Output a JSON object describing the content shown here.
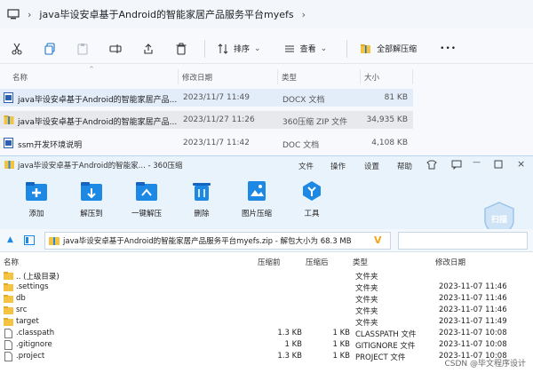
{
  "explorer": {
    "path": "java毕设安卓基于Android的智能家居产品服务平台myefs",
    "toolbar": {
      "sort_label": "排序",
      "view_label": "查看",
      "extract_all_label": "全部解压缩",
      "more_label": "•••"
    },
    "columns": {
      "name": "名称",
      "date": "修改日期",
      "type": "类型",
      "size": "大小"
    },
    "files": [
      {
        "name": "java毕设安卓基于Android的智能家居产品...",
        "date": "2023/11/7 11:49",
        "type": "DOCX 文档",
        "size": "81 KB"
      },
      {
        "name": "java毕设安卓基于Android的智能家居产品...",
        "date": "2023/11/27 11:26",
        "type": "360压缩 ZIP 文件",
        "size": "34,935 KB"
      },
      {
        "name": "ssm开发环境说明",
        "date": "2023/11/7 11:42",
        "type": "DOC 文档",
        "size": "4,108 KB"
      }
    ]
  },
  "zip": {
    "title": "java毕设安卓基于Android的智能家... - 360压缩",
    "menu": [
      "文件",
      "操作",
      "设置",
      "帮助"
    ],
    "ribbon": [
      {
        "label": "添加",
        "icon": "add-icon"
      },
      {
        "label": "解压到",
        "icon": "extract-to-icon"
      },
      {
        "label": "一键解压",
        "icon": "one-click-extract-icon"
      },
      {
        "label": "删除",
        "icon": "delete-icon"
      },
      {
        "label": "图片压缩",
        "icon": "image-compress-icon"
      },
      {
        "label": "工具",
        "icon": "tools-icon"
      }
    ],
    "scan_label": "扫描",
    "path_text": "java毕设安卓基于Android的智能家居产品服务平台myefs.zip - 解包大小为 68.3 MB",
    "columns": {
      "name": "名称",
      "before": "压缩前",
      "after": "压缩后",
      "type": "类型",
      "modified": "修改日期"
    },
    "rows": [
      {
        "name": ".. (上级目录)",
        "before": "",
        "after": "",
        "type": "文件夹",
        "date": "",
        "kind": "folder"
      },
      {
        "name": ".settings",
        "before": "",
        "after": "",
        "type": "文件夹",
        "date": "2023-11-07 11:46",
        "kind": "folder"
      },
      {
        "name": "db",
        "before": "",
        "after": "",
        "type": "文件夹",
        "date": "2023-11-07 11:46",
        "kind": "folder"
      },
      {
        "name": "src",
        "before": "",
        "after": "",
        "type": "文件夹",
        "date": "2023-11-07 11:46",
        "kind": "folder"
      },
      {
        "name": "target",
        "before": "",
        "after": "",
        "type": "文件夹",
        "date": "2023-11-07 11:49",
        "kind": "folder"
      },
      {
        "name": ".classpath",
        "before": "1.3 KB",
        "after": "1 KB",
        "type": "CLASSPATH 文件",
        "date": "2023-11-07 10:08",
        "kind": "file"
      },
      {
        "name": ".gitignore",
        "before": "1 KB",
        "after": "1 KB",
        "type": "GITIGNORE 文件",
        "date": "2023-11-07 10:08",
        "kind": "file"
      },
      {
        "name": ".project",
        "before": "1.3 KB",
        "after": "1 KB",
        "type": "PROJECT 文件",
        "date": "2023-11-07 10:08",
        "kind": "file"
      }
    ]
  },
  "watermark": "CSDN @毕文程序设计",
  "colors": {
    "accent": "#1e88e5",
    "folder": "#f5c342",
    "ribbon_bg": "#e9f3fc"
  }
}
